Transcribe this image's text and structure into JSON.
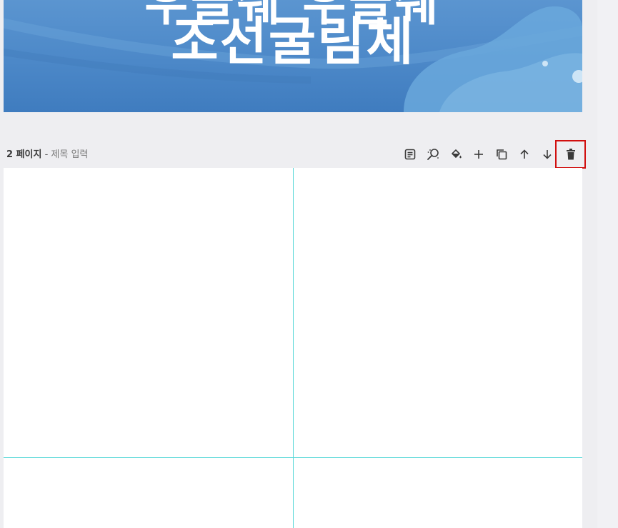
{
  "cover_page": {
    "title_line1": "우글쉐 우글쉐",
    "title_line2": "조선굴림체",
    "background_color": "#4c88c8"
  },
  "page2": {
    "page_number_label": "2 페이지",
    "separator": " - ",
    "title_placeholder": "제목 입력"
  },
  "toolbar": {
    "items": [
      {
        "name": "notes",
        "icon": "notes-icon"
      },
      {
        "name": "magic-switch",
        "icon": "magic-wand-icon"
      },
      {
        "name": "background-color",
        "icon": "paint-bucket-icon"
      },
      {
        "name": "add-page",
        "icon": "plus-icon"
      },
      {
        "name": "duplicate-page",
        "icon": "duplicate-icon"
      },
      {
        "name": "move-page-up",
        "icon": "arrow-up-icon"
      },
      {
        "name": "move-page-down",
        "icon": "arrow-down-icon"
      },
      {
        "name": "delete-page",
        "icon": "trash-icon",
        "highlighted": true
      }
    ],
    "highlight_color": "#d10f0f"
  },
  "guides": {
    "color": "#59d8d8"
  }
}
